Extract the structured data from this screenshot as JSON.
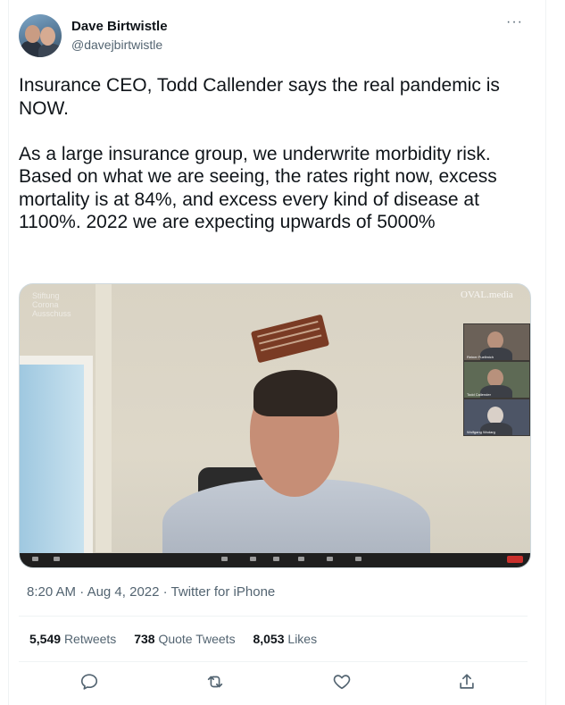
{
  "author": {
    "name": "Dave Birtwistle",
    "handle": "@davejbirtwistle"
  },
  "tweet": {
    "text": "Insurance CEO, Todd Callender says the real pandemic is NOW.\n\nAs a large insurance group, we underwrite morbidity risk. Based on what we are seeing, the rates right now, excess mortality is at 84%, and excess every kind of disease at 1100%. 2022 we are expecting upwards of 5000%"
  },
  "media": {
    "watermark_left": "Stiftung\nCorona\nAusschuss",
    "watermark_right": "OVAL.media",
    "participants": [
      "Reiner Fuellmich",
      "Todd Callender",
      "Wolfgang Wodarg"
    ]
  },
  "meta": {
    "time": "8:20 AM",
    "date": "Aug 4, 2022",
    "source": "Twitter for iPhone",
    "separator": "·"
  },
  "stats": {
    "retweets_count": "5,549",
    "retweets_label": "Retweets",
    "quotes_count": "738",
    "quotes_label": "Quote Tweets",
    "likes_count": "8,053",
    "likes_label": "Likes"
  },
  "menu": {
    "more_label": "···"
  },
  "icons": [
    "reply-icon",
    "retweet-icon",
    "like-icon",
    "share-icon"
  ]
}
